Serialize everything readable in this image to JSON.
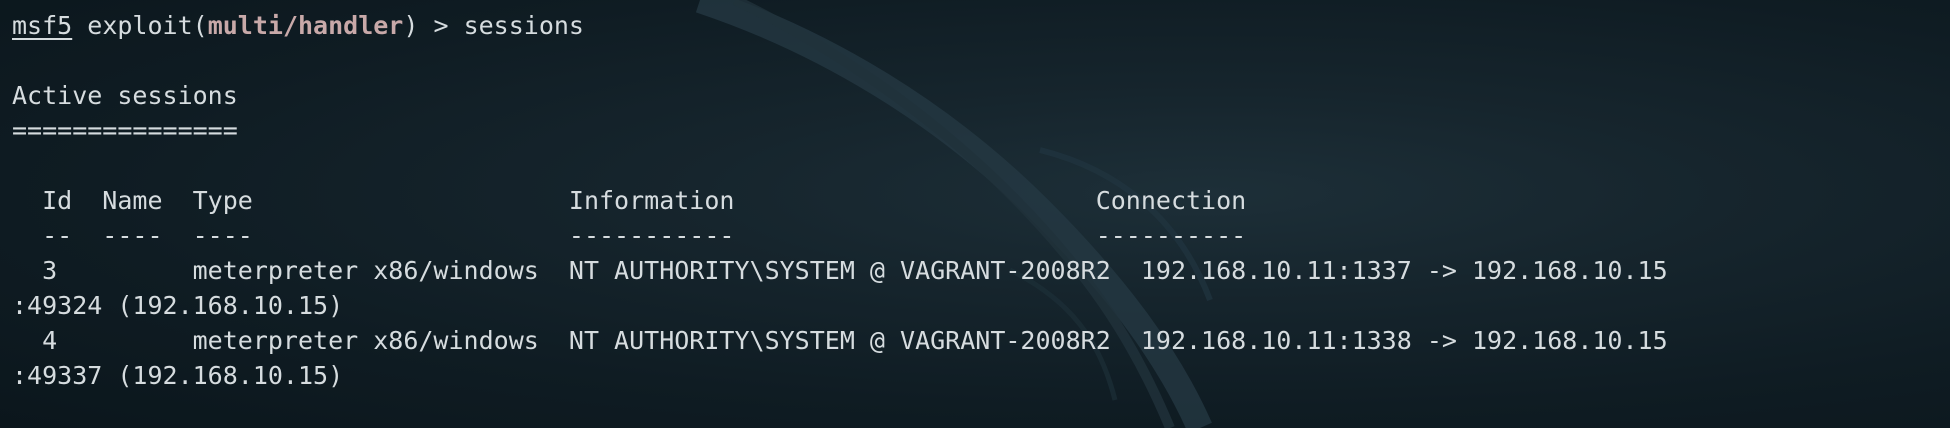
{
  "prompt": {
    "name": "msf5",
    "context_prefix": " exploit(",
    "module": "multi/handler",
    "context_suffix": ") > ",
    "command": "sessions"
  },
  "output": {
    "heading": "Active sessions",
    "underline": "===============",
    "header_row": "  Id  Name  Type                     Information                        Connection",
    "separator_row": "  --  ----  ----                     -----------                        ----------",
    "sessions": [
      {
        "line1": "  3         meterpreter x86/windows  NT AUTHORITY\\SYSTEM @ VAGRANT-2008R2  192.168.10.11:1337 -> 192.168.10.15",
        "line2": ":49324 (192.168.10.15)"
      },
      {
        "line1": "  4         meterpreter x86/windows  NT AUTHORITY\\SYSTEM @ VAGRANT-2008R2  192.168.10.11:1338 -> 192.168.10.15",
        "line2": ":49337 (192.168.10.15)"
      }
    ]
  },
  "colors": {
    "background": "#0e1b22",
    "text": "#d6dcdf",
    "module": "#c8a9a9"
  }
}
